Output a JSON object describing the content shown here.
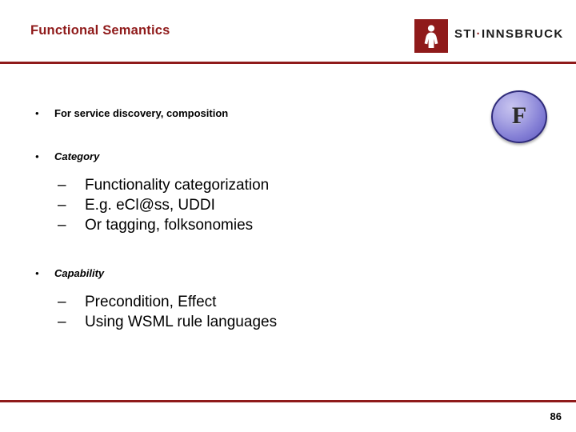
{
  "slide": {
    "title": "Functional Semantics",
    "page_number": "86",
    "accent_color": "#8f1a1a",
    "badge": {
      "letter": "F",
      "fill_color": "#8580d6",
      "border_color": "#2f2b7a"
    },
    "logo": {
      "icon_name": "sti-figure-icon",
      "text_primary": "STI",
      "separator": "·",
      "text_secondary": "INNSBRUCK"
    },
    "bullets": [
      {
        "level": 1,
        "marker": "•",
        "text": "For service discovery, composition",
        "italic": false
      },
      {
        "level": 1,
        "marker": "•",
        "text": "Category",
        "italic": true
      },
      {
        "level": 2,
        "marker": "–",
        "text": "Functionality categorization"
      },
      {
        "level": 2,
        "marker": "–",
        "text": "E.g. eCl@ss, UDDI"
      },
      {
        "level": 2,
        "marker": "–",
        "text": "Or tagging, folksonomies"
      },
      {
        "level": 1,
        "marker": "•",
        "text": "Capability",
        "italic": true
      },
      {
        "level": 2,
        "marker": "–",
        "text": "Precondition, Effect"
      },
      {
        "level": 2,
        "marker": "–",
        "text": "Using WSML rule languages"
      }
    ]
  }
}
